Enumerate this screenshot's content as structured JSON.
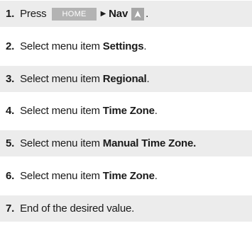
{
  "steps": [
    {
      "number": "1.",
      "press_label": "Press",
      "home_label": "HOME",
      "arrow": "▶",
      "nav_label": "Nav",
      "nav_icon": "navigation-arrow-icon",
      "suffix": "."
    },
    {
      "number": "2.",
      "text": "Select menu item",
      "bold": "Settings",
      "suffix": "."
    },
    {
      "number": "3.",
      "text": "Select menu item",
      "bold": "Regional",
      "suffix": "."
    },
    {
      "number": "4.",
      "text": "Select menu item",
      "bold": "Time Zone",
      "suffix": "."
    },
    {
      "number": "5.",
      "text": "Select menu item",
      "bold": "Manual Time Zone.",
      "suffix": ""
    },
    {
      "number": "6.",
      "text": "Select menu item",
      "bold": "Time Zone",
      "suffix": "."
    },
    {
      "number": "7.",
      "text": "End of the desired value.",
      "bold": "",
      "suffix": ""
    }
  ],
  "colors": {
    "shade": "#ececec",
    "home_button": "#b3b3b3",
    "nav_icon": "#a6a6a6"
  }
}
